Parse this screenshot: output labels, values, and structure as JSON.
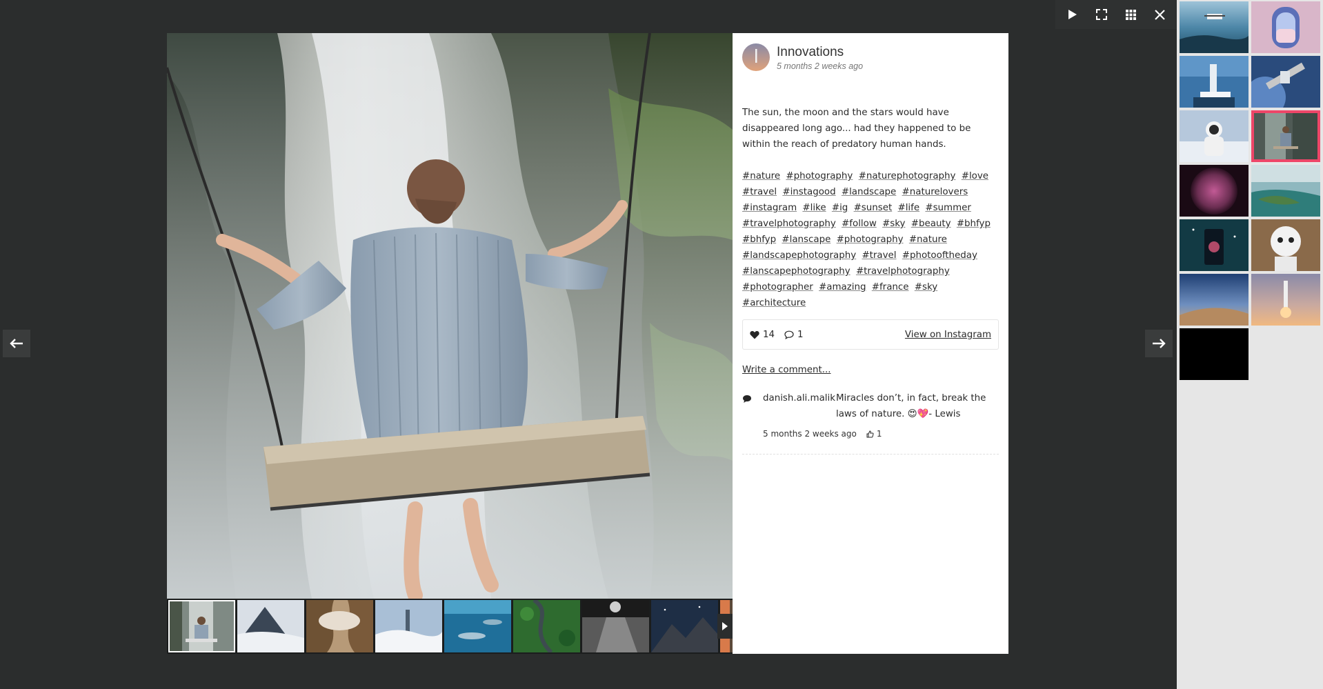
{
  "toolbar": {
    "icons": [
      "play-icon",
      "fullscreen-icon",
      "grid-icon",
      "close-icon"
    ]
  },
  "post": {
    "author": "Innovations",
    "time": "5 months 2 weeks ago",
    "caption": "The sun, the moon and the stars would have disappeared long ago... had they happened to be within the reach of predatory human hands.",
    "hashtags": [
      "#nature",
      "#photography",
      "#naturephotography",
      "#love",
      "#travel",
      "#instagood",
      "#landscape",
      "#naturelovers",
      "#instagram",
      "#like",
      "#ig",
      "#sunset",
      "#life",
      "#summer",
      "#travelphotography",
      "#follow",
      "#sky",
      "#beauty",
      "#bhfyp",
      "#bhfyp",
      "#lanscape",
      "#photography",
      "#nature",
      "#landscapephotography",
      "#travel",
      "#photooftheday",
      "#lanscapephotography",
      "#travelphotography",
      "#photographer",
      "#amazing",
      "#france",
      "#sky",
      "#architecture"
    ],
    "likes": "14",
    "comments_count": "1",
    "view_link": "View on Instagram",
    "write_comment": "Write a comment..."
  },
  "comment": {
    "user": "danish.ali.malik",
    "text": "Miracles don’t, in fact, break the laws of nature. 😍💖- Lewis",
    "time": "5 months 2 weeks ago",
    "likes": "1"
  },
  "colors": {
    "overlay": "#2b2d2d",
    "sidebar": "#e6e6e6",
    "selected_outline": "#ee4668"
  },
  "sidebar_thumbs": [
    "drone-over-sea",
    "airplane-window",
    "microscope",
    "satellite",
    "astronaut",
    "person-on-swing",
    "sun",
    "coastal-island",
    "phone-galaxy",
    "robot",
    "desert-milky-way",
    "rocket-launch",
    "black"
  ],
  "filmstrip_thumbs": [
    "person-on-swing",
    "mountain-clouds",
    "canyon-fog",
    "city-in-clouds",
    "dolphin-underwater",
    "forest-road",
    "moon-over-sea",
    "night-mountains",
    "partial"
  ]
}
